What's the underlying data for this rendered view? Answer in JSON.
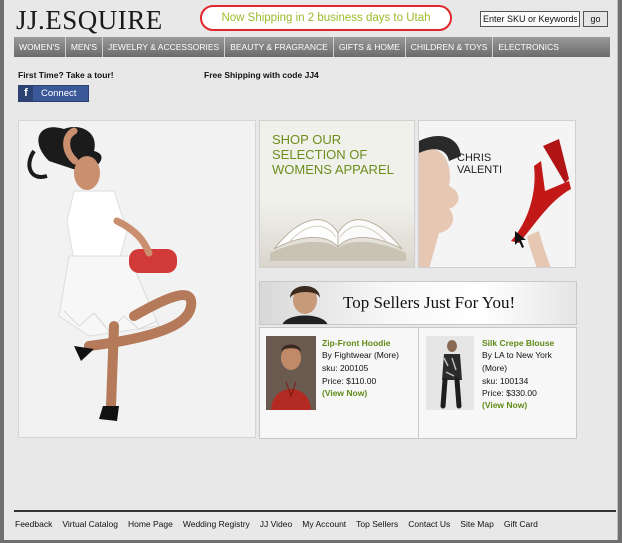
{
  "header": {
    "logo_text": "JJ.ESQUIRE",
    "promo_text": "Now Shipping in 2 business days to Utah",
    "search": {
      "placeholder": "Enter SKU or Keywords",
      "button_label": "go"
    }
  },
  "nav": {
    "items": [
      {
        "label": "WOMEN'S"
      },
      {
        "label": "MEN'S"
      },
      {
        "label": "JEWELRY & ACCESSORIES"
      },
      {
        "label": "BEAUTY & FRAGRANCE"
      },
      {
        "label": "GIFTS & HOME"
      },
      {
        "label": "CHILDREN & TOYS"
      },
      {
        "label": "ELECTRONICS"
      }
    ]
  },
  "subheader": {
    "first_time": "First Time?  Take a tour!",
    "free_shipping": "Free Shipping with code JJ4",
    "facebook_label": "Connect",
    "facebook_mark": "f"
  },
  "tiles": {
    "books_text": "SHOP OUR SELECTION OF WOMENS APPAREL",
    "chris_text": "CHRIS VALENTI"
  },
  "top_sellers": {
    "title": "Top Sellers Just For You!",
    "products": [
      {
        "name": "Zip-Front Hoodie",
        "by": "By Fightwear (More)",
        "sku": "sku: 200105",
        "price": "Price: $110.00",
        "view": "(View Now)"
      },
      {
        "name": "Silk Crepe Blouse",
        "by": "By LA to New York",
        "more": "(More)",
        "sku": "sku: 100134",
        "price": "Price: $330.00",
        "view": "(View Now)"
      }
    ]
  },
  "footer": {
    "links": [
      {
        "label": "Feedback"
      },
      {
        "label": "Virtual Catalog"
      },
      {
        "label": "Home Page"
      },
      {
        "label": "Wedding Registry"
      },
      {
        "label": "JJ Video"
      },
      {
        "label": "My Account"
      },
      {
        "label": "Top Sellers"
      },
      {
        "label": "Contact Us"
      },
      {
        "label": "Site Map"
      },
      {
        "label": "Gift Card"
      }
    ]
  },
  "colors": {
    "promo_border": "#e0262a",
    "promo_text": "#9bbb2a",
    "nav_bg": "#7d7d7d",
    "product_link": "#5f8a16",
    "facebook_blue": "#3b5998"
  }
}
